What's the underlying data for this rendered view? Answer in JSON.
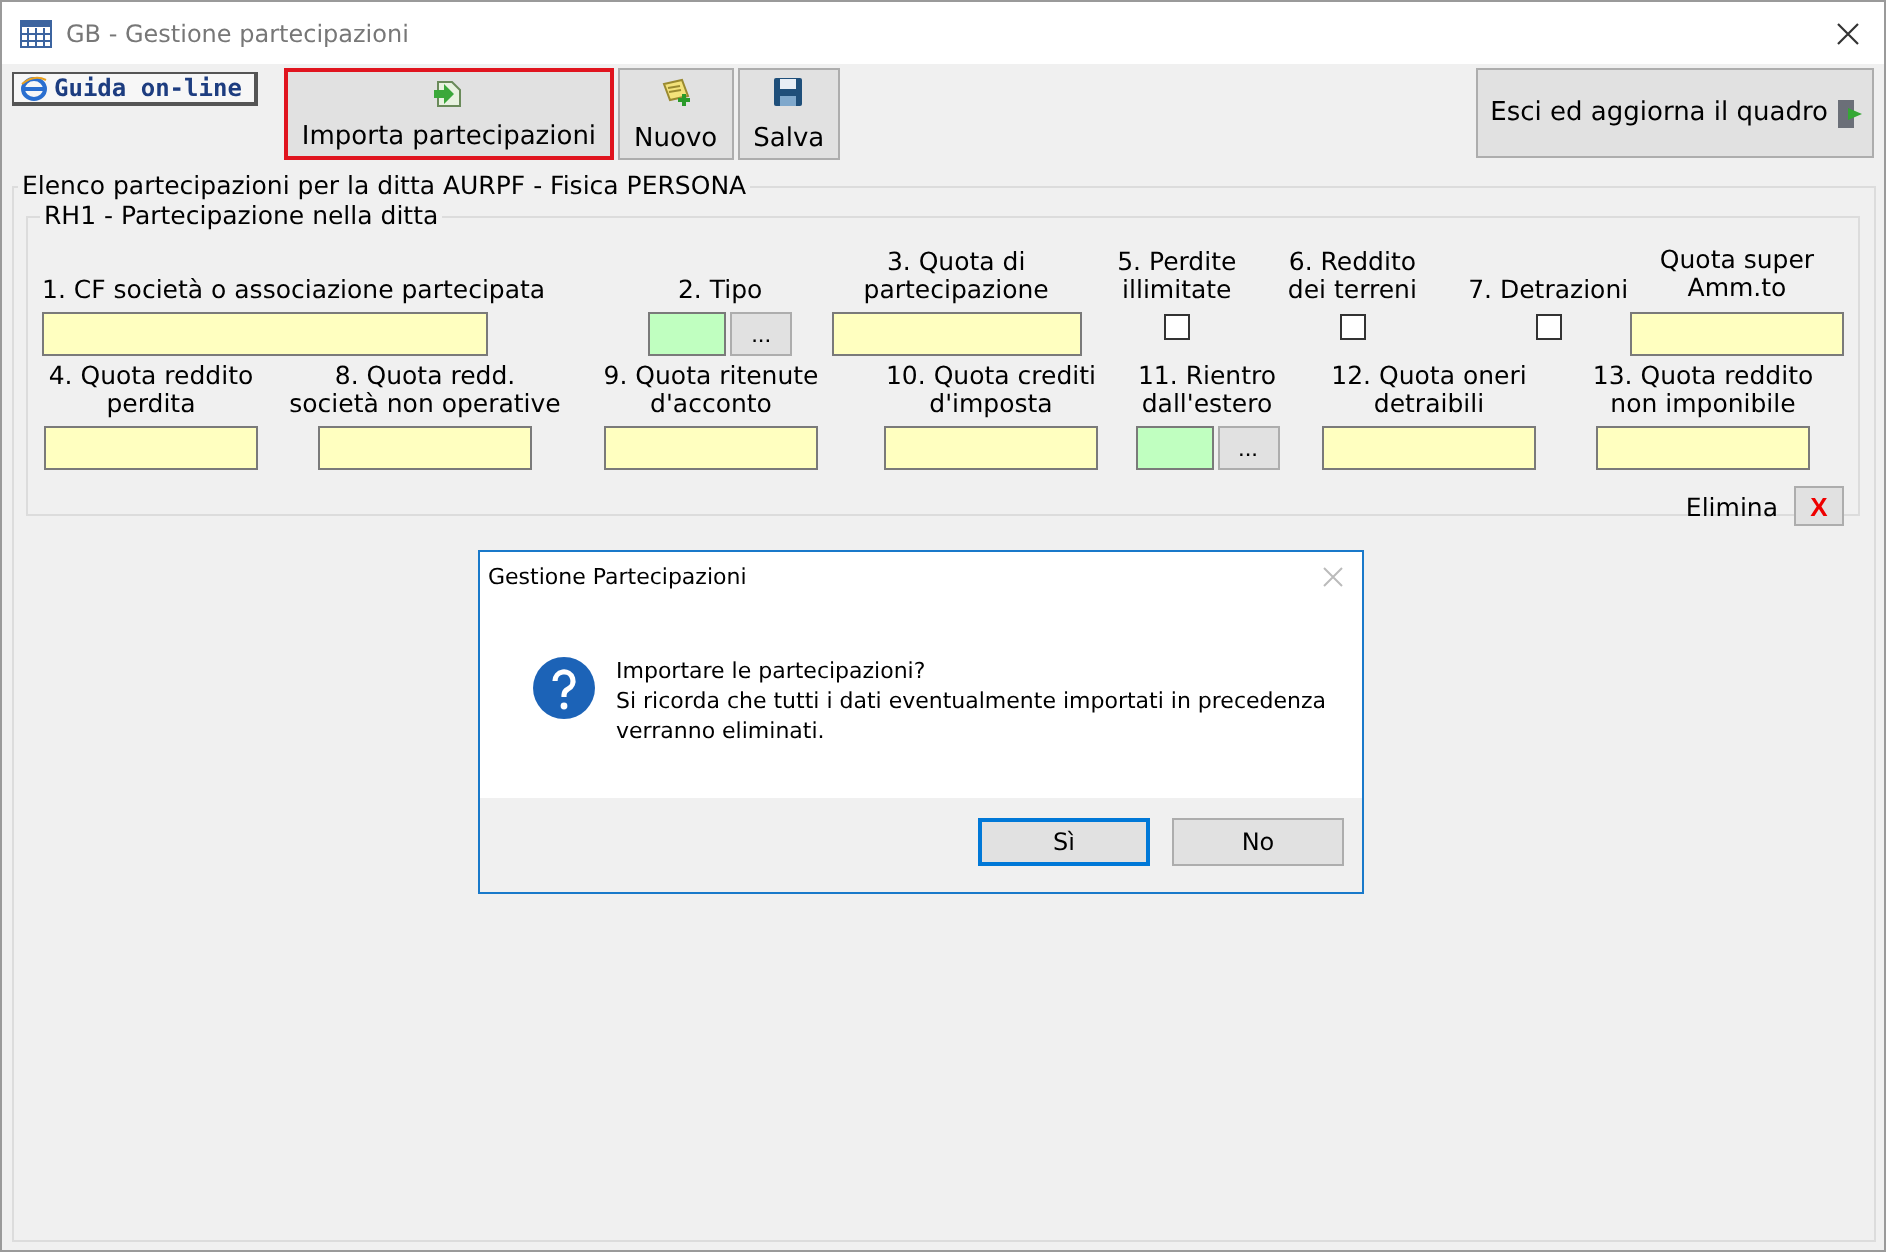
{
  "window": {
    "title": "GB - Gestione partecipazioni"
  },
  "toolbar": {
    "help": {
      "label": "Guida on-line"
    },
    "buttons": [
      {
        "label": "Importa partecipazioni",
        "selected": true
      },
      {
        "label": "Nuovo",
        "selected": false
      },
      {
        "label": "Salva",
        "selected": false
      }
    ],
    "exit": {
      "label": "Esci ed aggiorna il quadro"
    }
  },
  "list": {
    "title": "Elenco partecipazioni per la ditta AURPF - Fisica PERSONA",
    "section": {
      "title": "RH1 - Partecipazione nella ditta",
      "upper_fields": [
        {
          "label": "1. CF società o associazione partecipata",
          "kind": "text"
        },
        {
          "label": "2. Tipo",
          "kind": "code",
          "button": "..."
        },
        {
          "label": "3. Quota di\npartecipazione",
          "kind": "text"
        },
        {
          "label": "5. Perdite\nillimitate",
          "kind": "checkbox",
          "checked": false
        },
        {
          "label": "6. Reddito\ndei terreni",
          "kind": "checkbox",
          "checked": false
        },
        {
          "label": "7. Detrazioni",
          "kind": "checkbox",
          "checked": false
        },
        {
          "label": "Quota super\nAmm.to",
          "kind": "text"
        }
      ],
      "lower_fields": [
        {
          "label": "4. Quota reddito\nperdita",
          "kind": "text"
        },
        {
          "label": "8. Quota redd.\nsocietà non operative",
          "kind": "text"
        },
        {
          "label": "9. Quota ritenute\nd'acconto",
          "kind": "text"
        },
        {
          "label": "10. Quota crediti\nd'imposta",
          "kind": "text"
        },
        {
          "label": "11. Rientro\ndall'estero",
          "kind": "code",
          "button": "..."
        },
        {
          "label": "12. Quota oneri\ndetraibili",
          "kind": "text"
        },
        {
          "label": "13. Quota reddito\nnon imponibile",
          "kind": "text"
        }
      ],
      "delete": {
        "label": "Elimina",
        "button": "X"
      }
    }
  },
  "dialog": {
    "title": "Gestione Partecipazioni",
    "message": "Importare le partecipazioni?\nSi ricorda che tutti i dati eventualmente importati in precedenza\nverranno eliminati.",
    "buttons": [
      {
        "label": "Sì",
        "selected": true
      },
      {
        "label": "No",
        "selected": false
      }
    ]
  }
}
